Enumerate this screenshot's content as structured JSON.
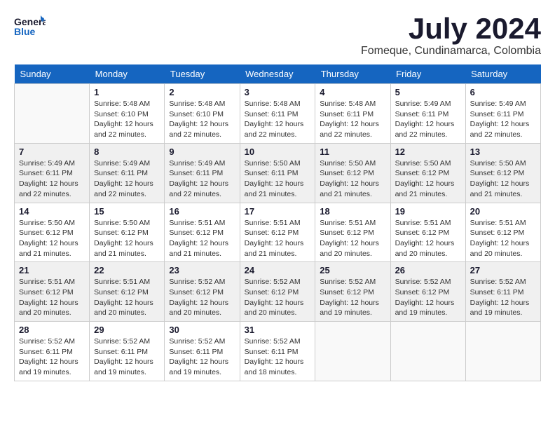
{
  "logo": {
    "general": "General",
    "blue": "Blue"
  },
  "title": "July 2024",
  "subtitle": "Fomeque, Cundinamarca, Colombia",
  "weekdays": [
    "Sunday",
    "Monday",
    "Tuesday",
    "Wednesday",
    "Thursday",
    "Friday",
    "Saturday"
  ],
  "weeks": [
    [
      {
        "day": "",
        "info": ""
      },
      {
        "day": "1",
        "info": "Sunrise: 5:48 AM\nSunset: 6:10 PM\nDaylight: 12 hours\nand 22 minutes."
      },
      {
        "day": "2",
        "info": "Sunrise: 5:48 AM\nSunset: 6:10 PM\nDaylight: 12 hours\nand 22 minutes."
      },
      {
        "day": "3",
        "info": "Sunrise: 5:48 AM\nSunset: 6:11 PM\nDaylight: 12 hours\nand 22 minutes."
      },
      {
        "day": "4",
        "info": "Sunrise: 5:48 AM\nSunset: 6:11 PM\nDaylight: 12 hours\nand 22 minutes."
      },
      {
        "day": "5",
        "info": "Sunrise: 5:49 AM\nSunset: 6:11 PM\nDaylight: 12 hours\nand 22 minutes."
      },
      {
        "day": "6",
        "info": "Sunrise: 5:49 AM\nSunset: 6:11 PM\nDaylight: 12 hours\nand 22 minutes."
      }
    ],
    [
      {
        "day": "7",
        "info": "Sunrise: 5:49 AM\nSunset: 6:11 PM\nDaylight: 12 hours\nand 22 minutes."
      },
      {
        "day": "8",
        "info": "Sunrise: 5:49 AM\nSunset: 6:11 PM\nDaylight: 12 hours\nand 22 minutes."
      },
      {
        "day": "9",
        "info": "Sunrise: 5:49 AM\nSunset: 6:11 PM\nDaylight: 12 hours\nand 22 minutes."
      },
      {
        "day": "10",
        "info": "Sunrise: 5:50 AM\nSunset: 6:11 PM\nDaylight: 12 hours\nand 21 minutes."
      },
      {
        "day": "11",
        "info": "Sunrise: 5:50 AM\nSunset: 6:12 PM\nDaylight: 12 hours\nand 21 minutes."
      },
      {
        "day": "12",
        "info": "Sunrise: 5:50 AM\nSunset: 6:12 PM\nDaylight: 12 hours\nand 21 minutes."
      },
      {
        "day": "13",
        "info": "Sunrise: 5:50 AM\nSunset: 6:12 PM\nDaylight: 12 hours\nand 21 minutes."
      }
    ],
    [
      {
        "day": "14",
        "info": "Sunrise: 5:50 AM\nSunset: 6:12 PM\nDaylight: 12 hours\nand 21 minutes."
      },
      {
        "day": "15",
        "info": "Sunrise: 5:50 AM\nSunset: 6:12 PM\nDaylight: 12 hours\nand 21 minutes."
      },
      {
        "day": "16",
        "info": "Sunrise: 5:51 AM\nSunset: 6:12 PM\nDaylight: 12 hours\nand 21 minutes."
      },
      {
        "day": "17",
        "info": "Sunrise: 5:51 AM\nSunset: 6:12 PM\nDaylight: 12 hours\nand 21 minutes."
      },
      {
        "day": "18",
        "info": "Sunrise: 5:51 AM\nSunset: 6:12 PM\nDaylight: 12 hours\nand 20 minutes."
      },
      {
        "day": "19",
        "info": "Sunrise: 5:51 AM\nSunset: 6:12 PM\nDaylight: 12 hours\nand 20 minutes."
      },
      {
        "day": "20",
        "info": "Sunrise: 5:51 AM\nSunset: 6:12 PM\nDaylight: 12 hours\nand 20 minutes."
      }
    ],
    [
      {
        "day": "21",
        "info": "Sunrise: 5:51 AM\nSunset: 6:12 PM\nDaylight: 12 hours\nand 20 minutes."
      },
      {
        "day": "22",
        "info": "Sunrise: 5:51 AM\nSunset: 6:12 PM\nDaylight: 12 hours\nand 20 minutes."
      },
      {
        "day": "23",
        "info": "Sunrise: 5:52 AM\nSunset: 6:12 PM\nDaylight: 12 hours\nand 20 minutes."
      },
      {
        "day": "24",
        "info": "Sunrise: 5:52 AM\nSunset: 6:12 PM\nDaylight: 12 hours\nand 20 minutes."
      },
      {
        "day": "25",
        "info": "Sunrise: 5:52 AM\nSunset: 6:12 PM\nDaylight: 12 hours\nand 19 minutes."
      },
      {
        "day": "26",
        "info": "Sunrise: 5:52 AM\nSunset: 6:12 PM\nDaylight: 12 hours\nand 19 minutes."
      },
      {
        "day": "27",
        "info": "Sunrise: 5:52 AM\nSunset: 6:11 PM\nDaylight: 12 hours\nand 19 minutes."
      }
    ],
    [
      {
        "day": "28",
        "info": "Sunrise: 5:52 AM\nSunset: 6:11 PM\nDaylight: 12 hours\nand 19 minutes."
      },
      {
        "day": "29",
        "info": "Sunrise: 5:52 AM\nSunset: 6:11 PM\nDaylight: 12 hours\nand 19 minutes."
      },
      {
        "day": "30",
        "info": "Sunrise: 5:52 AM\nSunset: 6:11 PM\nDaylight: 12 hours\nand 19 minutes."
      },
      {
        "day": "31",
        "info": "Sunrise: 5:52 AM\nSunset: 6:11 PM\nDaylight: 12 hours\nand 18 minutes."
      },
      {
        "day": "",
        "info": ""
      },
      {
        "day": "",
        "info": ""
      },
      {
        "day": "",
        "info": ""
      }
    ]
  ]
}
